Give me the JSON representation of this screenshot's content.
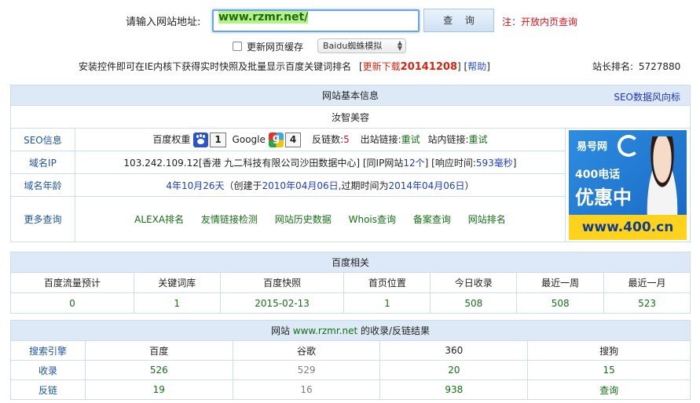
{
  "search": {
    "label": "请输入网站地址:",
    "value": "www.rzmr.net/",
    "button": "查 询",
    "note": "注：开放内页查询",
    "refresh_label": "更新网页缓存",
    "ua_selected": "Baidu蜘蛛模拟"
  },
  "install": {
    "text": "安装控件即可在IE内核下获得实时快照及批量显示百度关键词排名",
    "update_label": "更新下载",
    "update_version": "20141208",
    "help": "帮助"
  },
  "rank": {
    "label": "站长排名:",
    "value": "5727880"
  },
  "basic": {
    "title": "网站基本信息",
    "seo_wind": "SEO数据风向标",
    "site_name": "汝智美容",
    "seo_label": "SEO信息",
    "baidu_weight_label": "百度权重",
    "baidu_weight": "1",
    "google_label": "Google",
    "google_pr": "4",
    "backlinks_label": "反链数:",
    "backlinks": "5",
    "outlinks_label": "出站链接:",
    "outlinks_value": "重试",
    "inlinks_label": "站内链接:",
    "inlinks_value": "重试",
    "ip_label": "域名IP",
    "ip": "103.242.109.12",
    "ip_location": "[香港 九二科技有限公司沙田数据中心]",
    "same_ip_prefix": "[同IP网站",
    "same_ip_count": "12个",
    "same_ip_suffix": "]",
    "response_prefix": "[响应时间:",
    "response_time": "593毫秒",
    "response_suffix": "]",
    "age_label": "域名年龄",
    "age": "4年10月26天",
    "created_prefix": "（创建于",
    "created": "2010年04月06日",
    "expire_prefix": ",过期时间为",
    "expire": "2014年04月06日",
    "expire_suffix": "）",
    "more_label": "更多查询",
    "more_links": [
      "ALEXA排名",
      "友情链接检测",
      "网站历史数据",
      "Whois查询",
      "备案查询",
      "网站排名"
    ]
  },
  "ad": {
    "brand": "易号网",
    "line1": "400电话",
    "line2": "优惠中",
    "url": "www.400.cn",
    "colors": {
      "bg": "#1e74cf",
      "bar": "#ffd21e"
    }
  },
  "baidu": {
    "title": "百度相关",
    "headers": [
      "百度流量预计",
      "关键词库",
      "百度快照",
      "首页位置",
      "今日收录",
      "最近一周",
      "最近一月"
    ],
    "values": [
      "0",
      "1",
      "2015-02-13",
      "1",
      "508",
      "508",
      "523"
    ]
  },
  "results": {
    "title_prefix": "网站 ",
    "title_site": "www.rzmr.net",
    "title_suffix": " 的收录/反链结果",
    "headers": [
      "搜索引擎",
      "百度",
      "谷歌",
      "360",
      "搜狗"
    ],
    "index_label": "收录",
    "index": [
      "526",
      "529",
      "20",
      "15"
    ],
    "backlink_label": "反链",
    "backlinks": [
      "19",
      "16",
      "938",
      "查询"
    ]
  },
  "colors": {
    "header_bg": "#dde9f7",
    "border": "#cfdcec",
    "label_blue": "#1d55a3",
    "value_green": "#157014",
    "alert_red": "#e0101a"
  }
}
